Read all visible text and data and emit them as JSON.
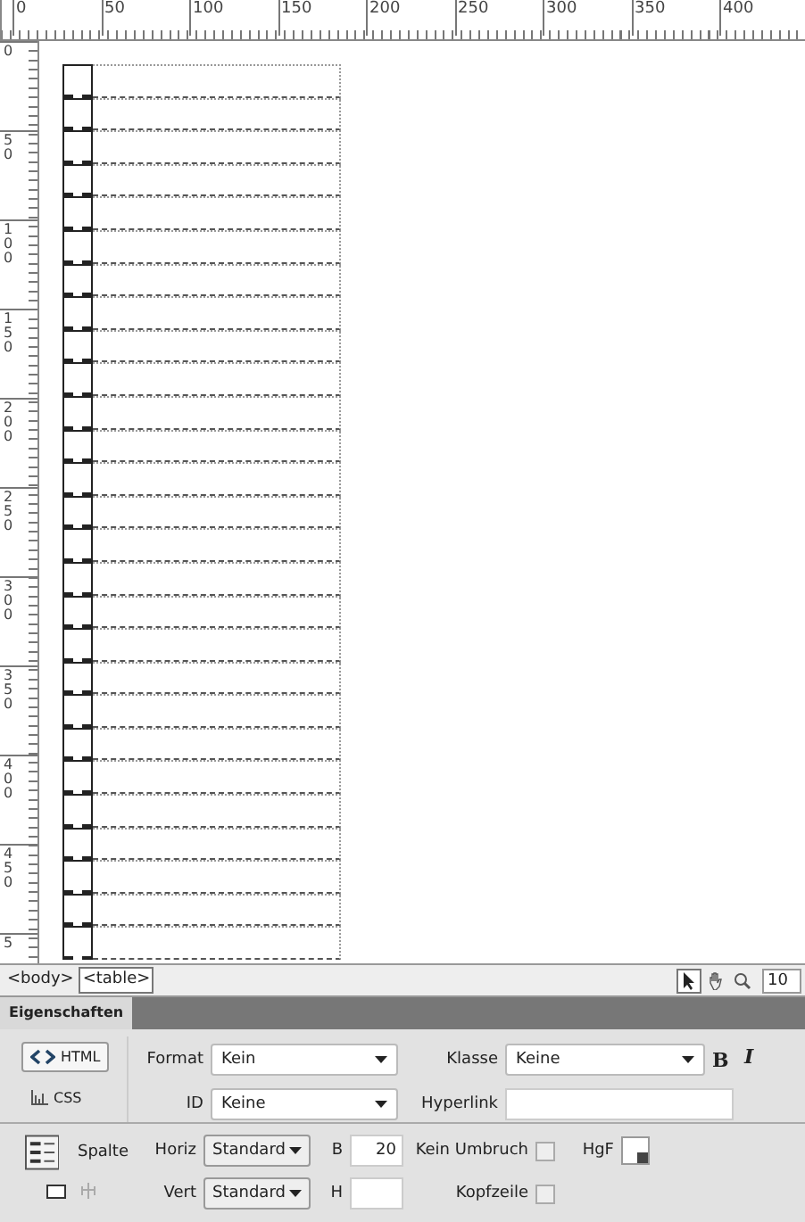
{
  "top_ruler": {
    "labels": [
      "0",
      "50",
      "100",
      "150",
      "200",
      "250",
      "300",
      "350",
      "400"
    ]
  },
  "left_ruler": {
    "labels": [
      "0",
      "50",
      "100",
      "150",
      "200",
      "250",
      "300",
      "350",
      "400",
      "450",
      "5"
    ]
  },
  "tag_selector": {
    "tags": [
      {
        "label": "<body>",
        "selected": false
      },
      {
        "label": "<table>",
        "selected": true
      }
    ],
    "tools": [
      {
        "kind": "pointer",
        "selected": true
      },
      {
        "kind": "hand",
        "selected": false
      },
      {
        "kind": "zoom",
        "selected": false
      }
    ],
    "zoom_value": "10"
  },
  "panel": {
    "tab": "Eigenschaften",
    "modes": [
      {
        "kind": "html",
        "label": "HTML",
        "selected": true
      },
      {
        "kind": "css",
        "label": "CSS",
        "selected": false
      }
    ],
    "format": {
      "label": "Format",
      "value": "Kein"
    },
    "class": {
      "label": "Klasse",
      "value": "Keine"
    },
    "id": {
      "label": "ID",
      "value": "Keine"
    },
    "hyperlink": {
      "label": "Hyperlink"
    },
    "bold": "B",
    "italic": "I",
    "cell": {
      "title": "Spalte",
      "horiz": {
        "label": "Horiz",
        "value": "Standard"
      },
      "vert": {
        "label": "Vert",
        "value": "Standard"
      },
      "width": {
        "label": "B",
        "value": "20"
      },
      "height": {
        "label": "H"
      },
      "nowrap": {
        "label": "Kein Umbruch",
        "checked": false
      },
      "header": {
        "label": "Kopfzeile",
        "checked": false
      },
      "bg": {
        "label": "HgF"
      }
    }
  }
}
